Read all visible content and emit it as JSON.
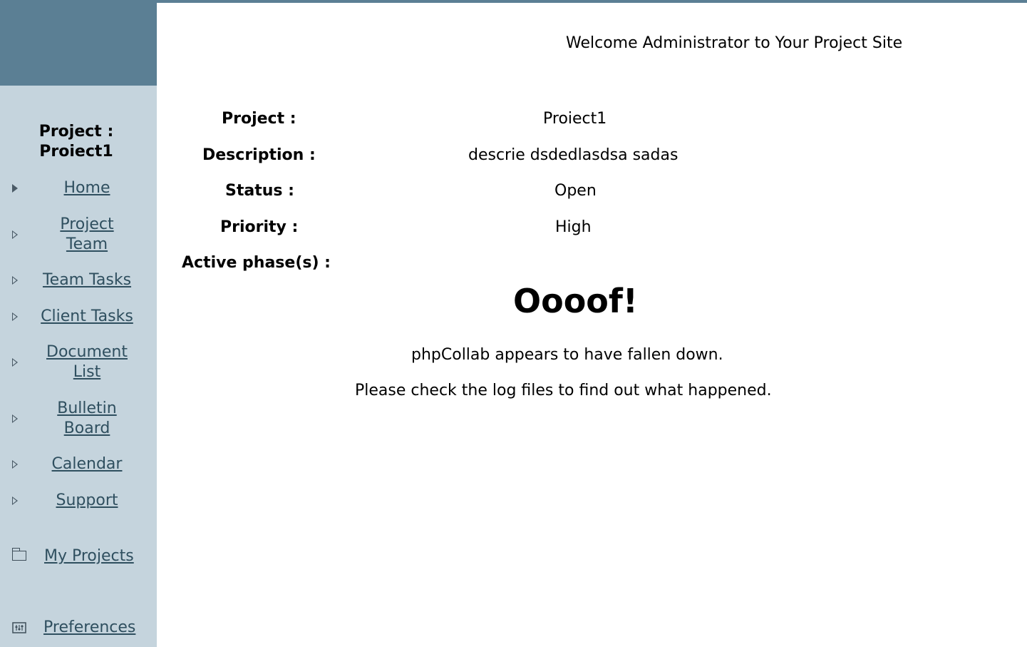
{
  "header": {
    "welcome": "Welcome Administrator to Your Project Site"
  },
  "sidebar": {
    "project_heading_line1": "Project :",
    "project_heading_line2": "Proiect1",
    "items": [
      {
        "label_line1": "Home",
        "label_line2": "",
        "icon": "triangle-right-icon"
      },
      {
        "label_line1": "Project",
        "label_line2": "Team",
        "icon": "triangle-right-icon"
      },
      {
        "label_line1": "Team Tasks",
        "label_line2": "",
        "icon": "triangle-right-icon"
      },
      {
        "label_line1": "Client Tasks",
        "label_line2": "",
        "icon": "triangle-right-icon"
      },
      {
        "label_line1": "Document",
        "label_line2": "List",
        "icon": "triangle-right-icon"
      },
      {
        "label_line1": "Bulletin",
        "label_line2": "Board",
        "icon": "triangle-right-icon"
      },
      {
        "label_line1": "Calendar",
        "label_line2": "",
        "icon": "triangle-right-icon"
      },
      {
        "label_line1": "Support",
        "label_line2": "",
        "icon": "triangle-right-icon"
      }
    ],
    "my_projects": {
      "label": "My Projects",
      "icon": "folder-icon"
    },
    "preferences": {
      "label": "Preferences",
      "icon": "preferences-icon"
    }
  },
  "project_info": {
    "project_label": "Project :",
    "project_value": "Proiect1",
    "description_label": "Description :",
    "description_value": "descrie dsdedlasdsa sadas",
    "status_label": "Status :",
    "status_value": "Open",
    "priority_label": "Priority :",
    "priority_value": "High",
    "active_phases_label": "Active phase(s) :"
  },
  "error": {
    "title": "Oooof!",
    "line1": "phpCollab appears to have fallen down.",
    "line2": "Please check the log files to find out what happened."
  },
  "colors": {
    "header_bar": "#5b7f94",
    "sidebar_bg": "#c5d4dd",
    "link": "#2f4f5f"
  }
}
